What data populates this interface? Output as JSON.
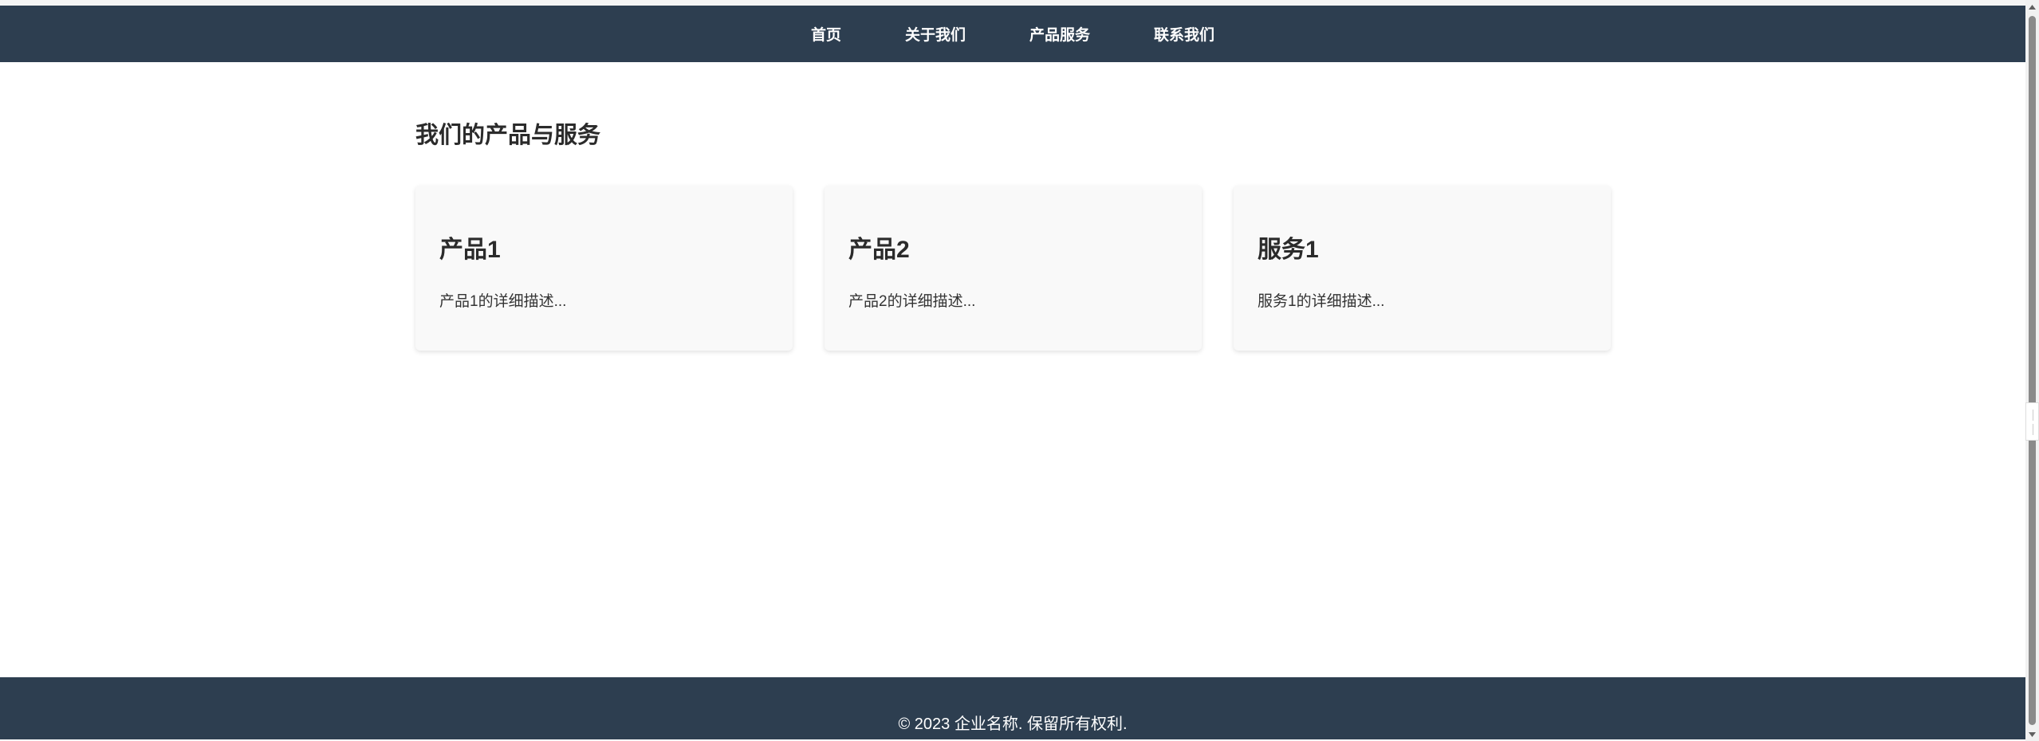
{
  "nav": {
    "items": [
      {
        "label": "首页"
      },
      {
        "label": "关于我们"
      },
      {
        "label": "产品服务"
      },
      {
        "label": "联系我们"
      }
    ]
  },
  "main": {
    "section_title": "我们的产品与服务",
    "cards": [
      {
        "title": "产品1",
        "description": "产品1的详细描述..."
      },
      {
        "title": "产品2",
        "description": "产品2的详细描述..."
      },
      {
        "title": "服务1",
        "description": "服务1的详细描述..."
      }
    ]
  },
  "footer": {
    "copyright": "© 2023 企业名称. 保留所有权利."
  },
  "colors": {
    "nav_background": "#2d3e50",
    "footer_background": "#2d3e50",
    "card_background": "#f9f9f9"
  },
  "icons": {
    "scroll_up": "triangle-up-icon",
    "scroll_down": "triangle-down-icon"
  }
}
